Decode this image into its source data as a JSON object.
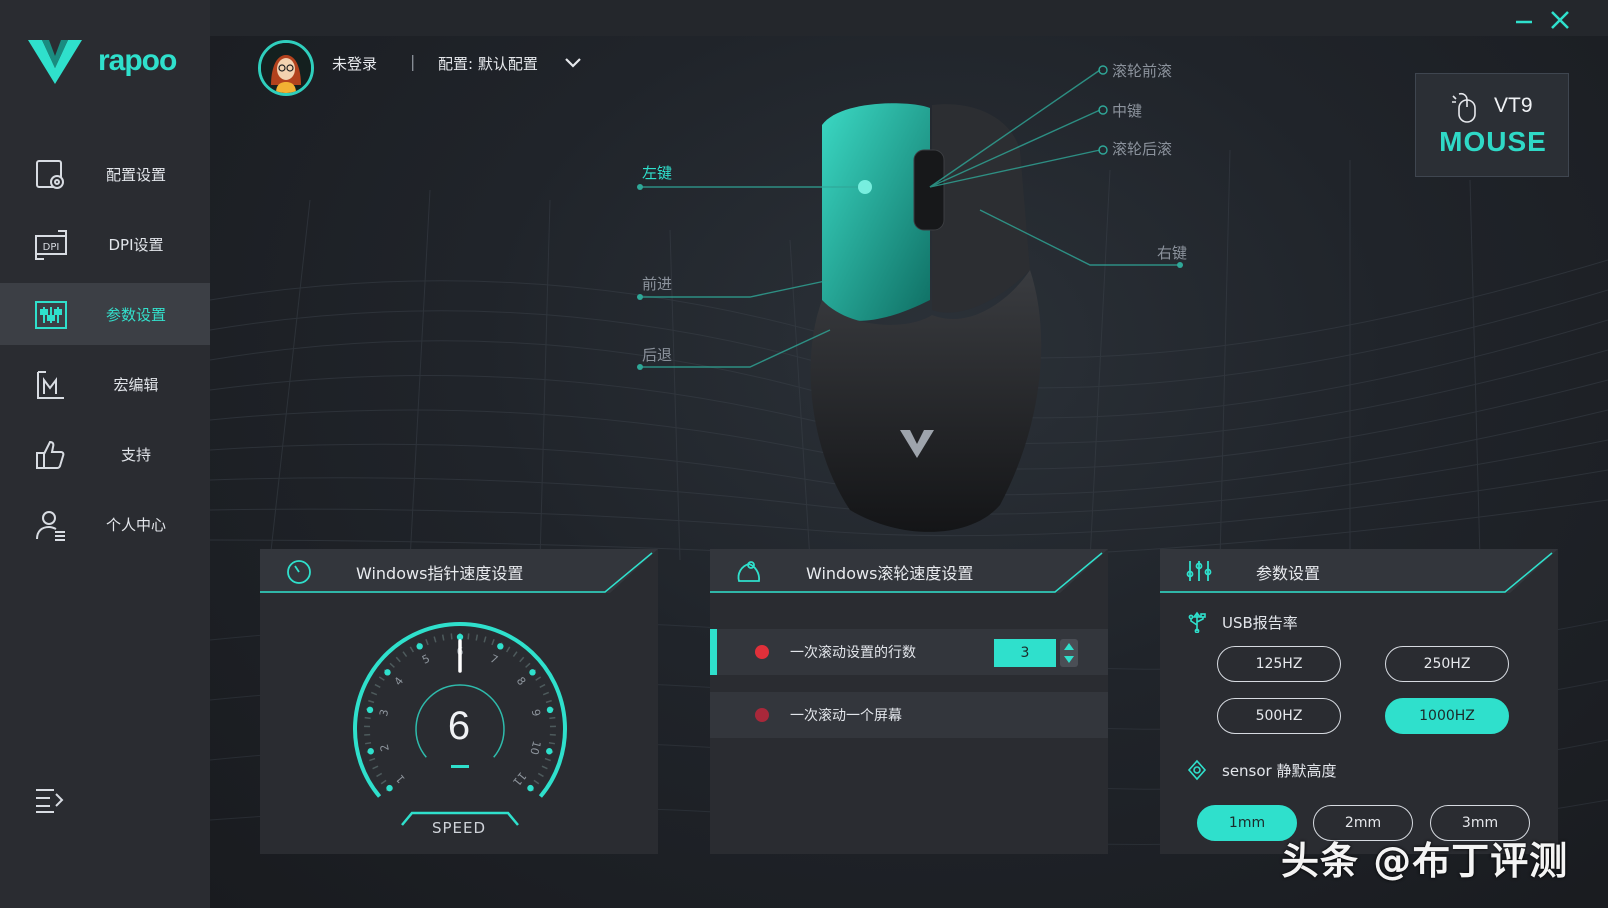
{
  "app": {
    "brand": "rapoo"
  },
  "window": {
    "minimize": "minimize",
    "close": "close"
  },
  "sidebar": {
    "items": [
      {
        "label": "配置设置",
        "icon": "profile-settings-icon"
      },
      {
        "label": "DPI设置",
        "icon": "dpi-icon"
      },
      {
        "label": "参数设置",
        "icon": "equalizer-icon"
      },
      {
        "label": "宏编辑",
        "icon": "macro-icon"
      },
      {
        "label": "支持",
        "icon": "thumbs-up-icon"
      },
      {
        "label": "个人中心",
        "icon": "user-icon"
      }
    ],
    "active": 2
  },
  "header": {
    "login": "未登录",
    "separator": "|",
    "config_label": "配置: 默认配置"
  },
  "device": {
    "model": "VT9",
    "type": "MOUSE"
  },
  "mouse_callouts": {
    "scroll_up": "滚轮前滚",
    "middle": "中键",
    "scroll_down": "滚轮后滚",
    "left": "左键",
    "right": "右键",
    "forward": "前进",
    "back": "后退"
  },
  "panels": {
    "pointer": {
      "title": "Windows指针速度设置",
      "value": "6",
      "caption": "SPEED",
      "ticks": [
        "1",
        "2",
        "3",
        "4",
        "5",
        "6",
        "7",
        "8",
        "9",
        "10",
        "11"
      ]
    },
    "scroll": {
      "title": "Windows滚轮速度设置",
      "row1_label": "一次滚动设置的行数",
      "row1_value": "3",
      "row2_label": "一次滚动一个屏幕"
    },
    "params": {
      "title": "参数设置",
      "usb_title": "USB报告率",
      "usb_options": [
        "125HZ",
        "250HZ",
        "500HZ",
        "1000HZ"
      ],
      "usb_selected": "1000HZ",
      "sensor_title": "sensor 静默高度",
      "sensor_options": [
        "1mm",
        "2mm",
        "3mm"
      ],
      "sensor_selected": "1mm"
    }
  },
  "colors": {
    "accent": "#2fe0cc",
    "sidebar": "#2a2c31",
    "panel": "#2a2c31",
    "indicator": "#e0303a"
  },
  "watermark": "头条 @布丁评测"
}
